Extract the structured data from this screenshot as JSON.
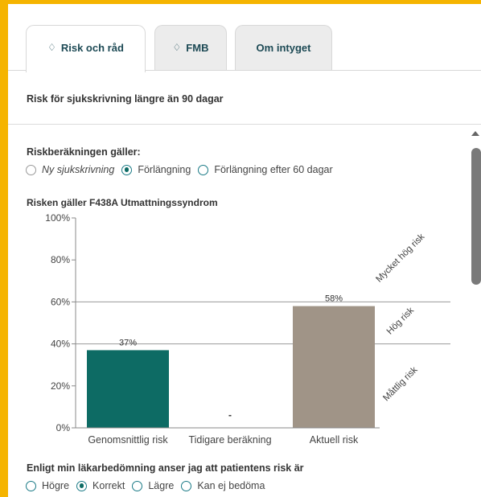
{
  "tabs": [
    {
      "label": "Risk och råd",
      "icon": "lightbulb-icon",
      "active": true
    },
    {
      "label": "FMB",
      "icon": "lightbulb-icon",
      "active": false
    },
    {
      "label": "Om intyget",
      "icon": "",
      "active": false
    }
  ],
  "header": {
    "title": "Risk för sjukskrivning längre än 90 dagar"
  },
  "risk_calc": {
    "label": "Riskberäkningen gäller:",
    "options": [
      {
        "label": "Ny sjukskrivning",
        "checked": false,
        "disabled": true
      },
      {
        "label": "Förlängning",
        "checked": true,
        "disabled": false
      },
      {
        "label": "Förlängning efter 60 dagar",
        "checked": false,
        "disabled": false
      }
    ]
  },
  "colors": {
    "accent": "#f5b400",
    "teal": "#0d6b64",
    "taupe": "#a09487",
    "link": "#1d4a55"
  },
  "chart_data": {
    "type": "bar",
    "title": "Risken gäller F438A Utmattningssyndrom",
    "categories": [
      "Genomsnittlig risk",
      "Tidigare beräkning",
      "Aktuell risk"
    ],
    "values": [
      37,
      null,
      58
    ],
    "value_labels": [
      "37%",
      "-",
      "58%"
    ],
    "bar_colors": [
      "#0d6b64",
      "#a09487",
      "#a09487"
    ],
    "ylim": [
      0,
      100
    ],
    "yticks": [
      0,
      20,
      40,
      60,
      80,
      100
    ],
    "ytick_labels": [
      "0%",
      "20%",
      "40%",
      "60%",
      "80%",
      "100%"
    ],
    "thresholds": [
      40,
      60
    ],
    "risk_zones": [
      {
        "label": "Måttlig risk",
        "from": 0,
        "to": 40
      },
      {
        "label": "Hög risk",
        "from": 40,
        "to": 60
      },
      {
        "label": "Mycket hög risk",
        "from": 60,
        "to": 100
      }
    ]
  },
  "assessment": {
    "label": "Enligt min läkarbedömning anser jag att patientens risk är",
    "options": [
      {
        "label": "Högre",
        "checked": false
      },
      {
        "label": "Korrekt",
        "checked": true
      },
      {
        "label": "Lägre",
        "checked": false
      },
      {
        "label": "Kan ej bedöma",
        "checked": false
      }
    ]
  }
}
